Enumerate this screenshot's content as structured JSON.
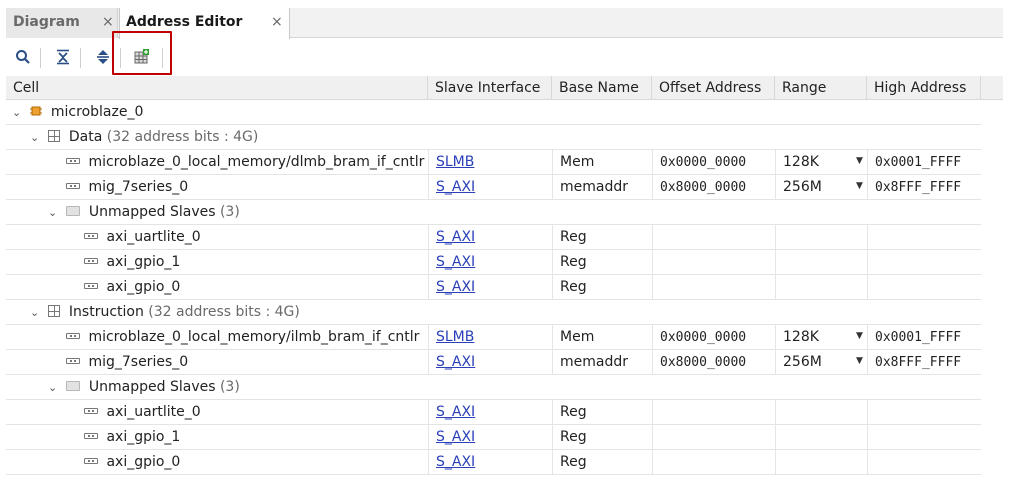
{
  "tabs": [
    {
      "label": "Diagram",
      "active": false
    },
    {
      "label": "Address Editor",
      "active": true
    }
  ],
  "tab_close_glyph": "×",
  "toolbar": {
    "buttons": [
      "search-icon",
      "collapse-all-icon",
      "expand-all-icon",
      "auto-assign-address-icon"
    ],
    "highlight_color": "#c00000"
  },
  "columns": [
    "Cell",
    "Slave Interface",
    "Base Name",
    "Offset Address",
    "Range",
    "High Address"
  ],
  "rows": [
    {
      "cell": "microblaze_0"
    },
    {
      "cell": "Data",
      "detail": "(32 address bits : 4G)"
    },
    {
      "cell": "microblaze_0_local_memory/dlmb_bram_if_cntlr",
      "slave": "SLMB",
      "base": "Mem",
      "offset": "0x0000_0000",
      "range": "128K",
      "high": "0x0001_FFFF"
    },
    {
      "cell": "mig_7series_0",
      "slave": "S_AXI",
      "base": "memaddr",
      "offset": "0x8000_0000",
      "range": "256M",
      "high": "0x8FFF_FFFF"
    },
    {
      "cell": "Unmapped Slaves",
      "detail": "(3)"
    },
    {
      "cell": "axi_uartlite_0",
      "slave": "S_AXI",
      "base": "Reg"
    },
    {
      "cell": "axi_gpio_1",
      "slave": "S_AXI",
      "base": "Reg"
    },
    {
      "cell": "axi_gpio_0",
      "slave": "S_AXI",
      "base": "Reg"
    },
    {
      "cell": "Instruction",
      "detail": "(32 address bits : 4G)"
    },
    {
      "cell": "microblaze_0_local_memory/ilmb_bram_if_cntlr",
      "slave": "SLMB",
      "base": "Mem",
      "offset": "0x0000_0000",
      "range": "128K",
      "high": "0x0001_FFFF"
    },
    {
      "cell": "mig_7series_0",
      "slave": "S_AXI",
      "base": "memaddr",
      "offset": "0x8000_0000",
      "range": "256M",
      "high": "0x8FFF_FFFF"
    },
    {
      "cell": "Unmapped Slaves",
      "detail": "(3)"
    },
    {
      "cell": "axi_uartlite_0",
      "slave": "S_AXI",
      "base": "Reg"
    },
    {
      "cell": "axi_gpio_1",
      "slave": "S_AXI",
      "base": "Reg"
    },
    {
      "cell": "axi_gpio_0",
      "slave": "S_AXI",
      "base": "Reg"
    }
  ],
  "colors": {
    "link": "#2a3fb8",
    "highlight": "#c00000"
  }
}
